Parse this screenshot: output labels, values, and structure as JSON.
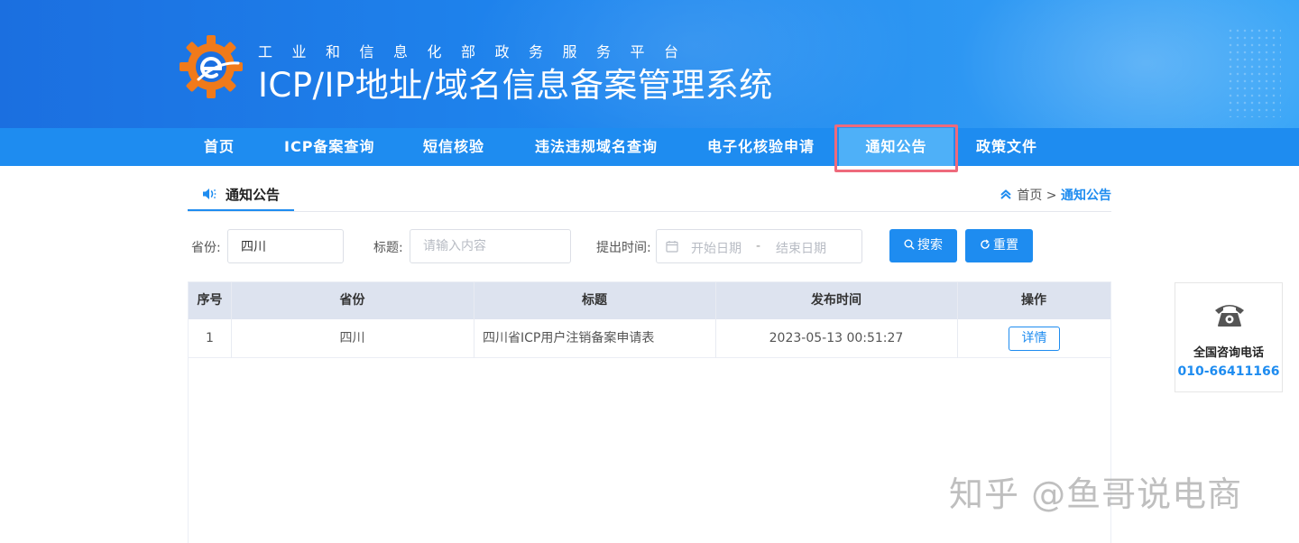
{
  "header": {
    "subtitle": "工业和信息化部政务服务平台",
    "title": "ICP/IP地址/域名信息备案管理系统",
    "brand_color": "#1e8cf0"
  },
  "nav": {
    "items": [
      {
        "label": "首页"
      },
      {
        "label": "ICP备案查询"
      },
      {
        "label": "短信核验"
      },
      {
        "label": "违法违规域名查询"
      },
      {
        "label": "电子化核验申请"
      },
      {
        "label": "通知公告",
        "active": true
      },
      {
        "label": "政策文件"
      }
    ]
  },
  "section": {
    "title": "通知公告",
    "icon": "speaker-icon"
  },
  "breadcrumb": {
    "home": "首页 >",
    "current": "通知公告"
  },
  "filters": {
    "province_label": "省份:",
    "province_value": "四川",
    "title_label": "标题:",
    "title_placeholder": "请输入内容",
    "time_label": "提出时间:",
    "start_placeholder": "开始日期",
    "range_separator": "-",
    "end_placeholder": "结束日期",
    "search_label": "搜索",
    "reset_label": "重置"
  },
  "table": {
    "columns": [
      "序号",
      "省份",
      "标题",
      "发布时间",
      "操作"
    ],
    "rows": [
      {
        "index": "1",
        "province": "四川",
        "title": "四川省ICP用户注销备案申请表",
        "time": "2023-05-13 00:51:27",
        "action": "详情"
      }
    ]
  },
  "contact": {
    "label": "全国咨询电话",
    "number": "010-66411166"
  },
  "watermark": "知乎 @鱼哥说电商"
}
